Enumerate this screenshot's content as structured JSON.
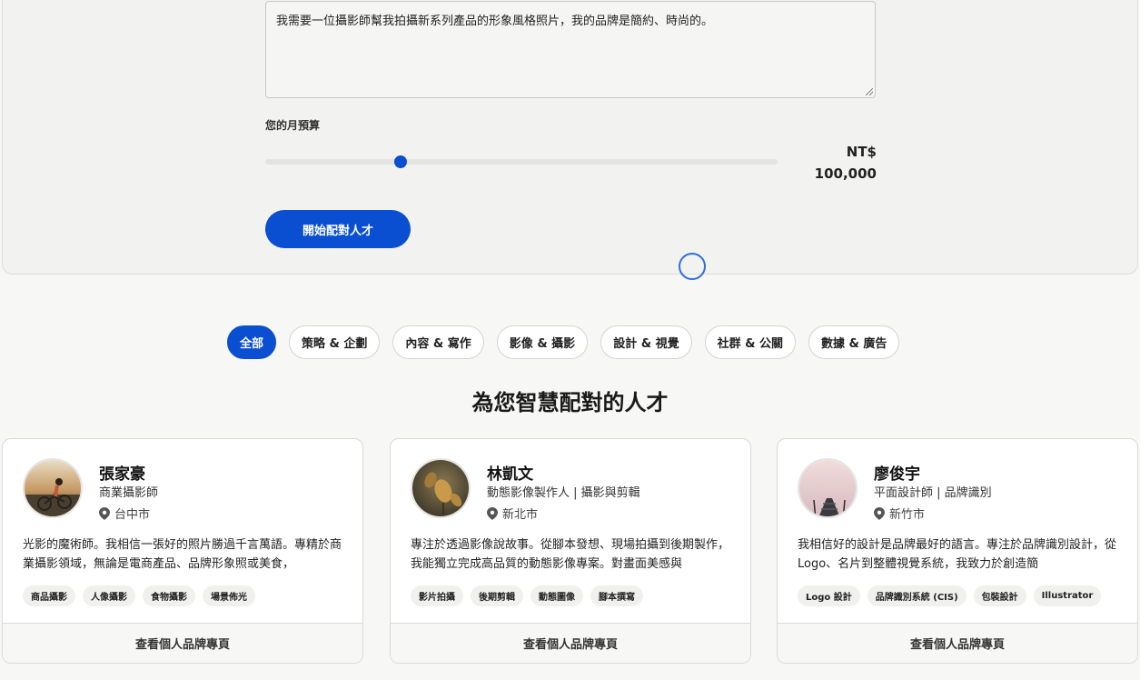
{
  "form": {
    "request_text": "我需要一位攝影師幫我拍攝新系列產品的形象風格照片，我的品牌是簡約、時尚的。",
    "budget_label": "您的月預算",
    "budget_currency": "NT$",
    "budget_amount": "100,000",
    "budget_slider_fraction": 0.265,
    "submit_label": "開始配對人才"
  },
  "categories": [
    "全部",
    "策略 & 企劃",
    "內容 & 寫作",
    "影像 & 攝影",
    "設計 & 視覺",
    "社群 & 公關",
    "數據 & 廣告"
  ],
  "active_category_index": 0,
  "section_title": "為您智慧配對的人才",
  "cards": [
    {
      "name": "張家豪",
      "role": "商業攝影師",
      "location": "台中市",
      "bio": "光影的魔術師。我相信一張好的照片勝過千言萬語。專精於商業攝影領域，無論是電商產品、品牌形象照或美食，",
      "tags": [
        "商品攝影",
        "人像攝影",
        "食物攝影",
        "場景佈光"
      ],
      "cta": "查看個人品牌專頁"
    },
    {
      "name": "林凱文",
      "role": "動態影像製作人 | 攝影與剪輯",
      "location": "新北市",
      "bio": "專注於透過影像說故事。從腳本發想、現場拍攝到後期製作，我能獨立完成高品質的動態影像專案。對畫面美感與",
      "tags": [
        "影片拍攝",
        "後期剪輯",
        "動態圖像",
        "腳本撰寫"
      ],
      "cta": "查看個人品牌專頁"
    },
    {
      "name": "廖俊宇",
      "role": "平面設計師 | 品牌識別",
      "location": "新竹市",
      "bio": "我相信好的設計是品牌最好的語言。專注於品牌識別設計，從 Logo、名片到整體視覺系統，我致力於創造簡",
      "tags": [
        "Logo 設計",
        "品牌識別系統 (CIS)",
        "包裝設計",
        "Illustrator"
      ],
      "cta": "查看個人品牌專頁"
    }
  ],
  "colors": {
    "accent": "#0a4fd1",
    "page_bg": "#f7f7f5"
  }
}
